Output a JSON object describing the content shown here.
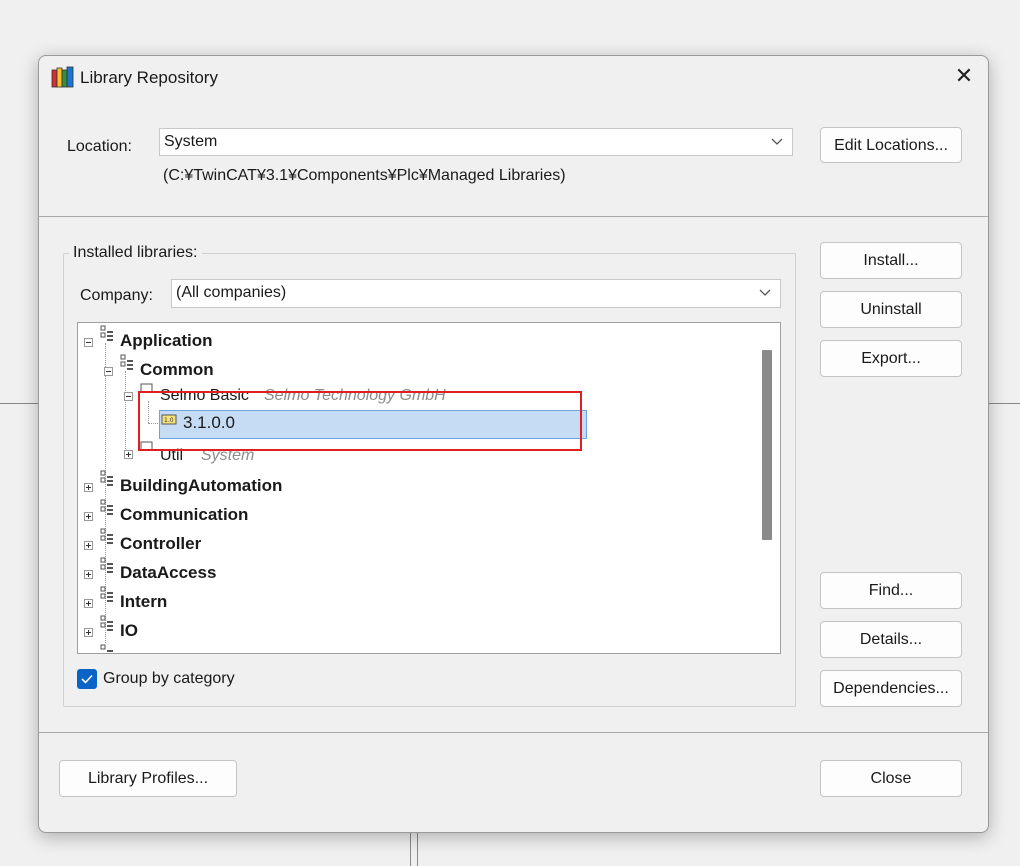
{
  "dialog": {
    "title": "Library Repository",
    "close_symbol": "✕"
  },
  "location": {
    "label": "Location:",
    "value": "System",
    "path": "(C:¥TwinCAT¥3.1¥Components¥Plc¥Managed Libraries)",
    "edit_button": "Edit Locations..."
  },
  "installed": {
    "group_title": "Installed libraries:",
    "company_label": "Company:",
    "company_value": "(All companies)",
    "tree": {
      "application": "Application",
      "common": "Common",
      "selmo_basic": "Selmo Basic",
      "selmo_company": "Selmo Technology GmbH",
      "version": "3.1.0.0",
      "util": "Util",
      "util_company": "System",
      "building_automation": "BuildingAutomation",
      "communication": "Communication",
      "controller": "Controller",
      "data_access": "DataAccess",
      "intern": "Intern",
      "io": "IO"
    },
    "group_by_category": "Group by category",
    "group_by_category_checked": true
  },
  "side_buttons": {
    "install": "Install...",
    "uninstall": "Uninstall",
    "export": "Export...",
    "find": "Find...",
    "details": "Details...",
    "dependencies": "Dependencies..."
  },
  "footer": {
    "library_profiles": "Library Profiles...",
    "close": "Close"
  },
  "colors": {
    "selection": "#c6dcf4",
    "highlight": "#e02020",
    "checkbox": "#0b63c5"
  }
}
